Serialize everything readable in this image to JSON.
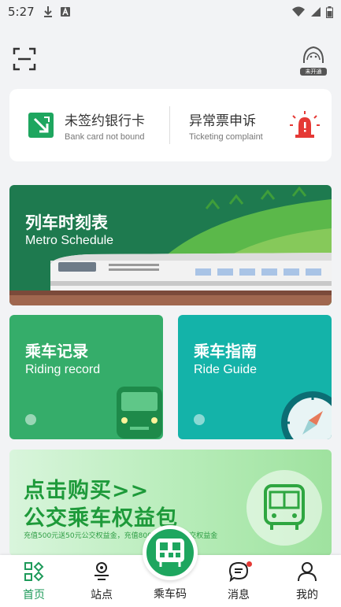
{
  "status_bar": {
    "time": "5:27"
  },
  "top_bar": {
    "avatar_caption": "未开通"
  },
  "quick_cards": [
    {
      "title": "未签约银行卡",
      "subtitle": "Bank card not bound",
      "icon": "bank-card-icon"
    },
    {
      "title": "异常票申诉",
      "subtitle": "Ticketing complaint",
      "icon": "alarm-icon"
    }
  ],
  "banner": {
    "title": "列车时刻表",
    "subtitle": "Metro Schedule"
  },
  "tiles": [
    {
      "title": "乘车记录",
      "subtitle": "Riding record",
      "color": "#35ad6a"
    },
    {
      "title": "乘车指南",
      "subtitle": "Ride Guide",
      "color": "#14b3a9"
    }
  ],
  "promo": {
    "line1": "点击购买>>",
    "line2": "公交乘车权益包",
    "fine_print": "充值500元送50元公交权益金，充值800元送80元公交权益金"
  },
  "bottom_nav": {
    "items": [
      {
        "label": "首页",
        "active": true
      },
      {
        "label": "站点",
        "active": false
      },
      {
        "label": "乘车码",
        "active": false
      },
      {
        "label": "消息",
        "active": false
      },
      {
        "label": "我的",
        "active": false
      }
    ]
  },
  "colors": {
    "accent": "#1ea65f",
    "banner": "#1e7a4f",
    "alert": "#e53935"
  }
}
